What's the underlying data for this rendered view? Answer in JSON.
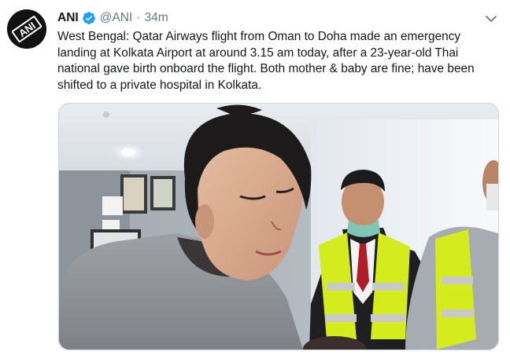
{
  "tweet": {
    "author_name": "ANI",
    "handle": "@ANI",
    "separator": "·",
    "time": "34m",
    "text": "West Bengal: Qatar Airways flight from Oman to Doha made an emergency landing at Kolkata Airport at around 3.15 am today, after a 23-year-old Thai national gave birth onboard the flight. Both mother & baby are fine; have been shifted to a private hospital in Kolkata.",
    "avatar_logo_text": "ANI"
  },
  "icons": {
    "verified": "verified-badge-icon",
    "caret": "chevron-down-icon"
  },
  "colors": {
    "verified": "#1da1f2",
    "secondary_text": "#657786",
    "vest": "#d4ec1e",
    "reflective_stripe": "#c9c9c9"
  }
}
